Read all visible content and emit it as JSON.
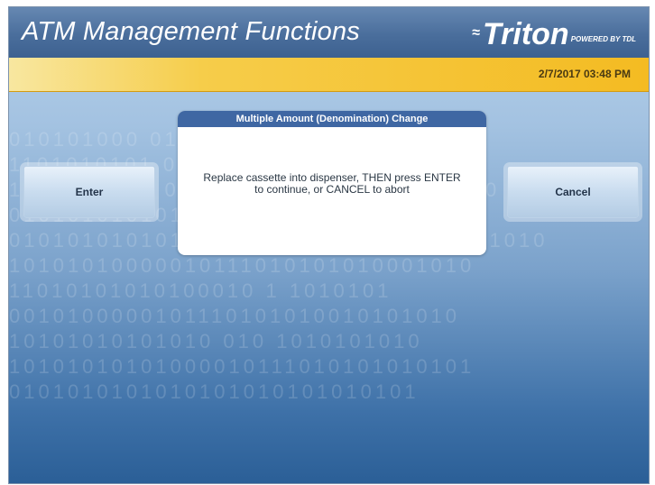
{
  "header": {
    "title": "ATM Management Functions",
    "brand_name": "Triton",
    "brand_tagline": "POWERED BY TDL"
  },
  "status": {
    "datetime": "2/7/2017 03:48 PM"
  },
  "dialog": {
    "title": "Multiple Amount (Denomination) Change",
    "message_line1": "Replace cassette into dispenser, THEN press ENTER",
    "message_line2": "to continue, or CANCEL to abort"
  },
  "buttons": {
    "enter_label": "Enter",
    "cancel_label": "Cancel"
  },
  "colors": {
    "header_blue": "#4a6e9c",
    "status_yellow": "#f4bb22",
    "dialog_title_blue": "#3f67a3",
    "background_blue": "#7ba2cb"
  },
  "icons": {
    "brand_mark": "triton-logo-icon"
  }
}
